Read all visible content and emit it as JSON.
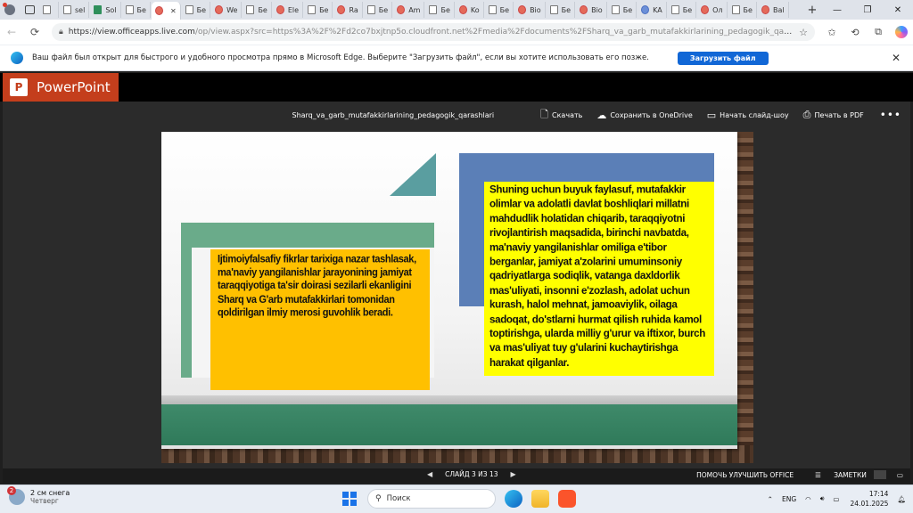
{
  "browser": {
    "tabs": [
      {
        "label": "",
        "icon": "profile"
      },
      {
        "label": "sel",
        "icon": "search"
      },
      {
        "label": "Sol",
        "icon": "green"
      },
      {
        "label": "Бе",
        "icon": "doc"
      },
      {
        "label": "",
        "icon": "red-active"
      },
      {
        "label": "Бе",
        "icon": "doc"
      },
      {
        "label": "We",
        "icon": "red"
      },
      {
        "label": "Бе",
        "icon": "doc"
      },
      {
        "label": "Ele",
        "icon": "red"
      },
      {
        "label": "Бе",
        "icon": "doc"
      },
      {
        "label": "Ra",
        "icon": "red"
      },
      {
        "label": "Бе",
        "icon": "doc"
      },
      {
        "label": "Am",
        "icon": "red"
      },
      {
        "label": "Бе",
        "icon": "doc"
      },
      {
        "label": "Ko",
        "icon": "red"
      },
      {
        "label": "Бе",
        "icon": "doc"
      },
      {
        "label": "Bio",
        "icon": "red"
      },
      {
        "label": "Бе",
        "icon": "doc"
      },
      {
        "label": "Bio",
        "icon": "red"
      },
      {
        "label": "Бе",
        "icon": "doc"
      },
      {
        "label": "KA",
        "icon": "blue"
      },
      {
        "label": "Бе",
        "icon": "doc"
      },
      {
        "label": "Ол",
        "icon": "red"
      },
      {
        "label": "Бе",
        "icon": "doc"
      },
      {
        "label": "Bal",
        "icon": "red"
      }
    ],
    "url_host": "https://view.officeapps.live.com",
    "url_path": "/op/view.aspx?src=https%3A%2F%2Fd2co7bxjtnp5o.cloudfront.net%2Fmedia%2Fdocuments%2FSharq_va_garb_mutafakkirlarining_pedagogik_qarashlari..."
  },
  "infobar": {
    "text": "Ваш файл был открыт для быстрого и удобного просмотра прямо в Microsoft Edge. Выберите \"Загрузить файл\", если вы хотите использовать его позже.",
    "button": "Загрузить файл"
  },
  "ppt": {
    "app_name": "PowerPoint",
    "doc_name": "Sharq_va_garb_mutafakkirlarining_pedagogik_qarashlari",
    "actions": {
      "download": "Скачать",
      "save_onedrive": "Сохранить в OneDrive",
      "slideshow": "Начать слайд-шоу",
      "print_pdf": "Печать в PDF"
    },
    "slide": {
      "left_text": "Ijtimoiyfalsafiy fikrlar tarixiga nazar tashlasak, ma'naviy yangilanishlar jarayonining jamiyat taraqqiyotiga ta'sir doirasi sezilarli ekanligini Sharq va G'arb mutafakkirlari tomonidan qoldirilgan ilmiy merosi guvohlik beradi.",
      "right_text": "Shuning uchun buyuk faylasuf, mutafakkir olimlar va adolatli davlat boshliqlari millatni mahdudlik holatidan chiqarib, taraqqiyotni rivojlantirish maqsadida, birinchi navbatda, ma'naviy yangilanishlar omiliga e'tibor berganlar, jamiyat a'zolarini umuminsoniy qadriyatlarga sodiqlik, vatanga daxldorlik mas'uliyati, insonni e'zozlash, adolat uchun kurash, halol mehnat, jamoaviylik, oilaga sadoqat, do'stlarni hurmat qilish ruhida kamol toptirishga, ularda milliy g'urur va iftixor, burch va mas'uliyat tuy g'ularini kuchaytirishga harakat qilganlar."
    },
    "status": {
      "slide_indicator": "СЛАЙД 3 ИЗ 13",
      "improve": "ПОМОЧЬ УЛУЧШИТЬ OFFICE",
      "notes": "ЗАМЕТКИ"
    }
  },
  "taskbar": {
    "weather_title": "2 см снега",
    "weather_sub": "Четверг",
    "weather_badge": "2",
    "search_placeholder": "Поиск",
    "lang": "ENG",
    "time": "17:14",
    "date": "24.01.2025"
  }
}
